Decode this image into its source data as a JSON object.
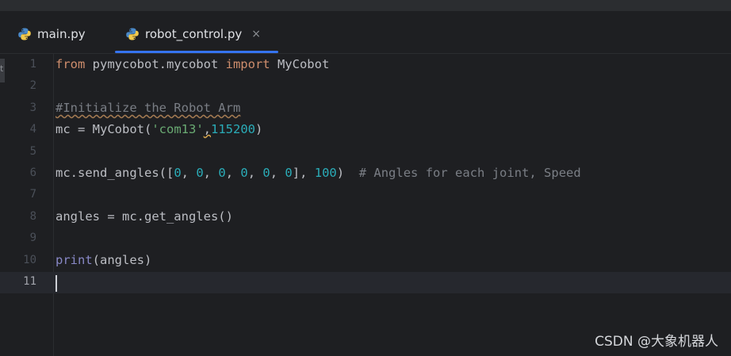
{
  "tabs": [
    {
      "label": "main.py",
      "icon": "python-icon",
      "active": false
    },
    {
      "label": "robot_control.py",
      "icon": "python-icon",
      "active": true,
      "close": "×"
    }
  ],
  "accent_color": "#3574f0",
  "editor": {
    "current_line": 11,
    "line_numbers": [
      "1",
      "2",
      "3",
      "4",
      "5",
      "6",
      "7",
      "8",
      "9",
      "10",
      "11"
    ],
    "lines": [
      {
        "parts": [
          {
            "t": "from",
            "c": "kw"
          },
          {
            "t": " pymycobot.mycobot ",
            "c": "fn"
          },
          {
            "t": "import",
            "c": "kw"
          },
          {
            "t": " MyCobot",
            "c": "fn"
          }
        ]
      },
      {
        "parts": []
      },
      {
        "parts": [
          {
            "t": "#Initialize the Robot Arm",
            "c": "cmt cmt-wavy"
          }
        ]
      },
      {
        "parts": [
          {
            "t": "mc = MyCobot(",
            "c": "fn"
          },
          {
            "t": "'com13'",
            "c": "str"
          },
          {
            "t": ",",
            "c": "comma-warn"
          },
          {
            "t": "115200",
            "c": "num"
          },
          {
            "t": ")",
            "c": "fn"
          }
        ]
      },
      {
        "parts": []
      },
      {
        "parts": [
          {
            "t": "mc.send_angles([",
            "c": "fn"
          },
          {
            "t": "0",
            "c": "num"
          },
          {
            "t": ", ",
            "c": "fn"
          },
          {
            "t": "0",
            "c": "num"
          },
          {
            "t": ", ",
            "c": "fn"
          },
          {
            "t": "0",
            "c": "num"
          },
          {
            "t": ", ",
            "c": "fn"
          },
          {
            "t": "0",
            "c": "num"
          },
          {
            "t": ", ",
            "c": "fn"
          },
          {
            "t": "0",
            "c": "num"
          },
          {
            "t": ", ",
            "c": "fn"
          },
          {
            "t": "0",
            "c": "num"
          },
          {
            "t": "], ",
            "c": "fn"
          },
          {
            "t": "100",
            "c": "num"
          },
          {
            "t": ")  ",
            "c": "fn"
          },
          {
            "t": "# Angles for each joint, Speed",
            "c": "cmt"
          }
        ]
      },
      {
        "parts": []
      },
      {
        "parts": [
          {
            "t": "angles = mc.get_angles()",
            "c": "fn"
          }
        ]
      },
      {
        "parts": []
      },
      {
        "parts": [
          {
            "t": "print",
            "c": "builtin"
          },
          {
            "t": "(angles)",
            "c": "fn"
          }
        ]
      },
      {
        "parts": []
      }
    ]
  },
  "watermark": "CSDN @大象机器人",
  "left_strip_glyph": "t"
}
